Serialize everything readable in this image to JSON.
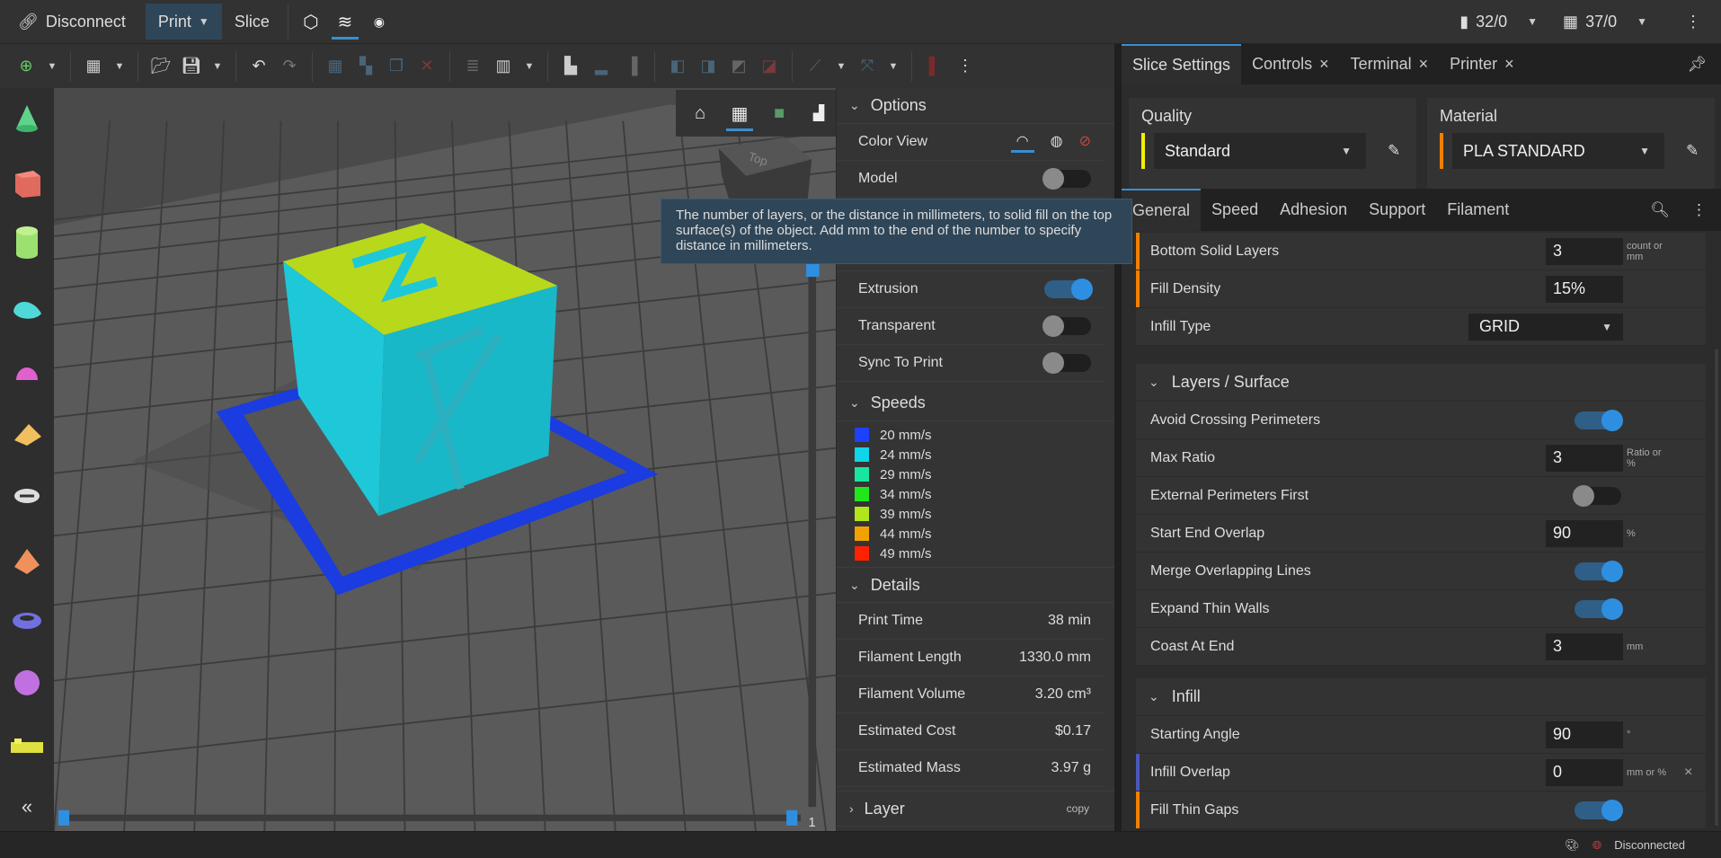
{
  "topbar": {
    "disconnect": "Disconnect",
    "print": "Print",
    "slice": "Slice",
    "extruder_count": "32/0",
    "bed_count": "37/0"
  },
  "toolbar": {
    "icons": [
      "add-part",
      "dropdown",
      "grid",
      "dropdown",
      "open-folder",
      "save",
      "dropdown",
      "undo",
      "redo",
      "arrange",
      "arrange-grid",
      "copy",
      "delete",
      "layers-thin",
      "layers",
      "dropdown",
      "align-left",
      "align-bottom",
      "align-right",
      "boolean-union",
      "boolean-subtract",
      "boolean-intersect",
      "boolean-paint",
      "mirror",
      "dropdown",
      "scale",
      "dropdown",
      "cut",
      "more"
    ]
  },
  "view_tools": [
    "home",
    "grid-view",
    "model-view",
    "layers-view"
  ],
  "options": {
    "title": "Options",
    "color_view": "Color View",
    "rows": [
      {
        "label": "Model",
        "on": false
      },
      {
        "label": "Extrusion",
        "on": true
      },
      {
        "label": "Transparent",
        "on": false
      },
      {
        "label": "Sync To Print",
        "on": false
      }
    ]
  },
  "tooltip": "The number of layers, or the distance in millimeters, to solid fill on the top surface(s) of the object. Add mm to the end of the number to specify distance in millimeters.",
  "speeds": {
    "title": "Speeds",
    "items": [
      {
        "label": "20 mm/s",
        "color": "#1e40ff"
      },
      {
        "label": "24 mm/s",
        "color": "#10d4e8"
      },
      {
        "label": "29 mm/s",
        "color": "#18e6a0"
      },
      {
        "label": "34 mm/s",
        "color": "#22e61c"
      },
      {
        "label": "39 mm/s",
        "color": "#b0e61a"
      },
      {
        "label": "44 mm/s",
        "color": "#f2a100"
      },
      {
        "label": "49 mm/s",
        "color": "#ff2200"
      }
    ]
  },
  "details": {
    "title": "Details",
    "rows": [
      {
        "label": "Print Time",
        "value": "38 min"
      },
      {
        "label": "Filament Length",
        "value": "1330.0 mm"
      },
      {
        "label": "Filament Volume",
        "value": "3.20 cm³"
      },
      {
        "label": "Estimated Cost",
        "value": "$0.17"
      },
      {
        "label": "Estimated Mass",
        "value": "3.97 g"
      }
    ]
  },
  "layer": {
    "title": "Layer",
    "copy": "copy"
  },
  "slider": {
    "layer_value": "1"
  },
  "nav_cube": {
    "label": "Top"
  },
  "right_tabs": [
    {
      "label": "Slice Settings"
    },
    {
      "label": "Controls",
      "close": "×"
    },
    {
      "label": "Terminal",
      "close": "×"
    },
    {
      "label": "Printer",
      "close": "×"
    }
  ],
  "quality": {
    "label": "Quality",
    "value": "Standard",
    "color": "#f0f000"
  },
  "material": {
    "label": "Material",
    "value": "PLA STANDARD",
    "color": "#f08000"
  },
  "sub_tabs": [
    "General",
    "Speed",
    "Adhesion",
    "Support",
    "Filament"
  ],
  "settings": {
    "group1": [
      {
        "label": "Bottom Solid Layers",
        "value": "3",
        "unit": "count or mm",
        "ind": "#f08000"
      },
      {
        "label": "Fill Density",
        "value": "15%",
        "ind": "#f08000"
      },
      {
        "label": "Infill Type",
        "select": "GRID"
      }
    ],
    "layers_surface": {
      "title": "Layers / Surface",
      "rows": [
        {
          "label": "Avoid Crossing Perimeters",
          "toggle": true
        },
        {
          "label": "Max Ratio",
          "value": "3",
          "unit": "Ratio or %"
        },
        {
          "label": "External Perimeters First",
          "toggle": false
        },
        {
          "label": "Start End Overlap",
          "value": "90",
          "unit": "%"
        },
        {
          "label": "Merge Overlapping Lines",
          "toggle": true
        },
        {
          "label": "Expand Thin Walls",
          "toggle": true
        },
        {
          "label": "Coast At End",
          "value": "3",
          "unit": "mm"
        }
      ]
    },
    "infill": {
      "title": "Infill",
      "rows": [
        {
          "label": "Starting Angle",
          "value": "90",
          "unit": "°"
        },
        {
          "label": "Infill Overlap",
          "value": "0",
          "unit": "mm or %",
          "ind": "#4a58b8",
          "clear": "×"
        },
        {
          "label": "Fill Thin Gaps",
          "toggle": true,
          "ind": "#f08000"
        }
      ]
    }
  },
  "status": {
    "connection": "Disconnected"
  }
}
